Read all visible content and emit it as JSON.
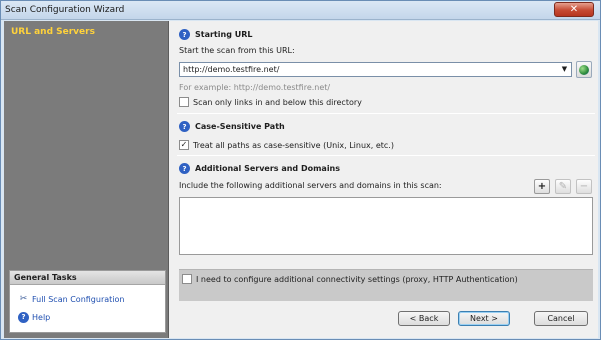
{
  "window": {
    "title": "Scan Configuration Wizard",
    "close_label": "✕"
  },
  "sidebar": {
    "active_step": "URL and Servers",
    "tasks_title": "General Tasks",
    "tasks": [
      {
        "label": "Full Scan Configuration",
        "icon": "tools-icon"
      },
      {
        "label": "Help",
        "icon": "help-icon"
      }
    ]
  },
  "starting_url": {
    "title": "Starting URL",
    "prompt": "Start the scan from this URL:",
    "value": "http://demo.testfire.net/",
    "example": "For example: http://demo.testfire.net/",
    "scan_only_label": "Scan only links in and below this directory",
    "scan_only_checked": false
  },
  "case_sensitive": {
    "title": "Case-Sensitive Path",
    "treat_label": "Treat all paths as case-sensitive (Unix, Linux, etc.)",
    "treat_checked": true
  },
  "additional": {
    "title": "Additional Servers and Domains",
    "prompt": "Include the following additional servers and domains in this scan:",
    "items": []
  },
  "connectivity": {
    "label": "I need to configure additional connectivity settings (proxy, HTTP Authentication)",
    "checked": false
  },
  "buttons": {
    "back": "< Back",
    "next": "Next >",
    "cancel": "Cancel"
  }
}
